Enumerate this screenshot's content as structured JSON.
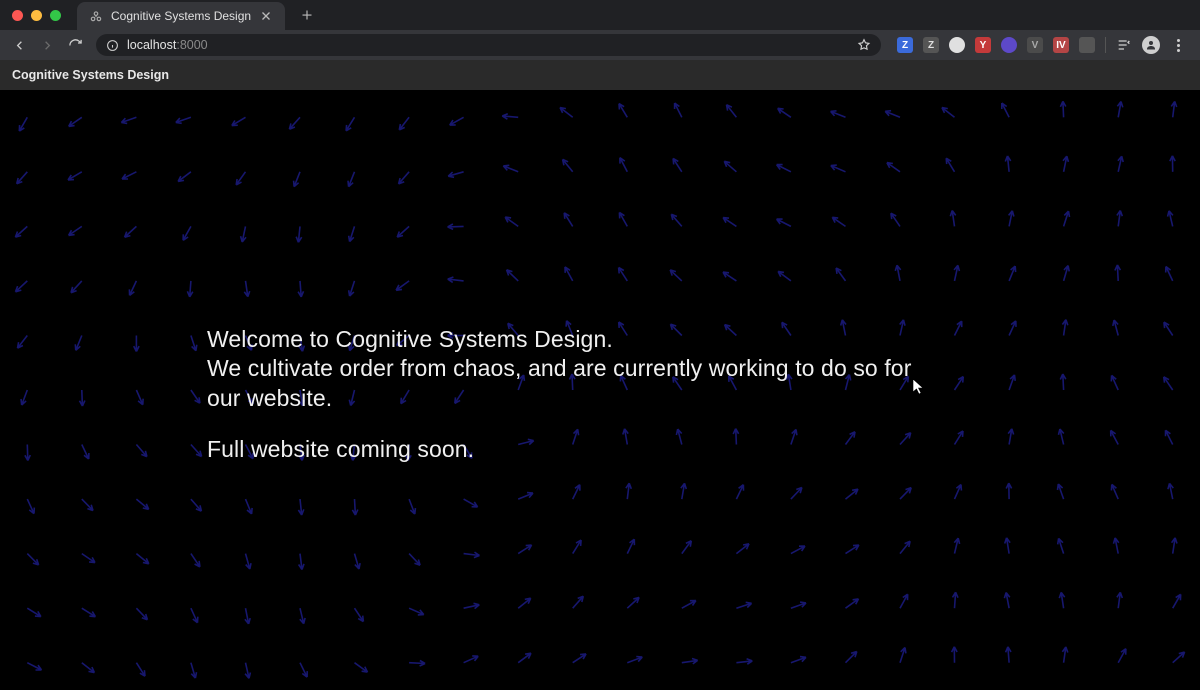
{
  "browser": {
    "tab_title": "Cognitive Systems Design",
    "url_host": "localhost",
    "url_port": ":8000"
  },
  "page": {
    "header": "Cognitive Systems Design",
    "paragraph1_a": "Welcome to Cognitive Systems Design.",
    "paragraph1_b": "We cultivate order from chaos, and are currently working to do so for our website.",
    "paragraph2": "Full website coming soon."
  },
  "colors": {
    "arrow": "#1a1a7a"
  }
}
